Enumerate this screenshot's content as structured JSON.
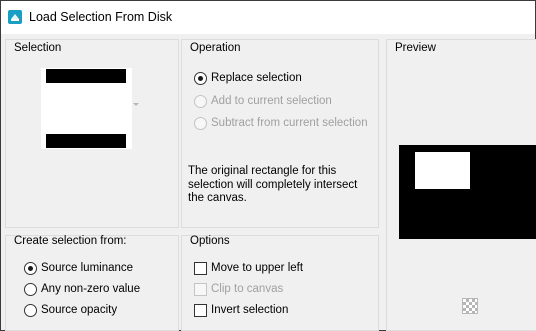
{
  "window": {
    "title": "Load Selection From Disk",
    "icon": "app-selection-icon"
  },
  "selection": {
    "title": "Selection"
  },
  "operation": {
    "title": "Operation",
    "options": [
      {
        "label": "Replace selection",
        "checked": true,
        "enabled": true
      },
      {
        "label": "Add to current selection",
        "checked": false,
        "enabled": false
      },
      {
        "label": "Subtract from current selection",
        "checked": false,
        "enabled": false
      }
    ],
    "info_lines": [
      "The original rectangle for this",
      "selection will completely intersect",
      "the canvas."
    ]
  },
  "preview": {
    "title": "Preview",
    "toggle_icon": "checkerboard-icon"
  },
  "create_from": {
    "title": "Create selection from:",
    "options": [
      {
        "label": "Source luminance",
        "checked": true
      },
      {
        "label": "Any non-zero value",
        "checked": false
      },
      {
        "label": "Source opacity",
        "checked": false
      }
    ]
  },
  "options": {
    "title": "Options",
    "items": [
      {
        "label": "Move to upper left",
        "checked": false,
        "enabled": true
      },
      {
        "label": "Clip to canvas",
        "checked": false,
        "enabled": false
      },
      {
        "label": "Invert selection",
        "checked": false,
        "enabled": true
      }
    ]
  },
  "colors": {
    "window_bg": "#f0f0f0",
    "titlebar_bg": "#ffffff",
    "panel_border": "#dcdcdc",
    "disabled_text": "#a0a0a0",
    "icon_teal": "#1a9fc4"
  }
}
